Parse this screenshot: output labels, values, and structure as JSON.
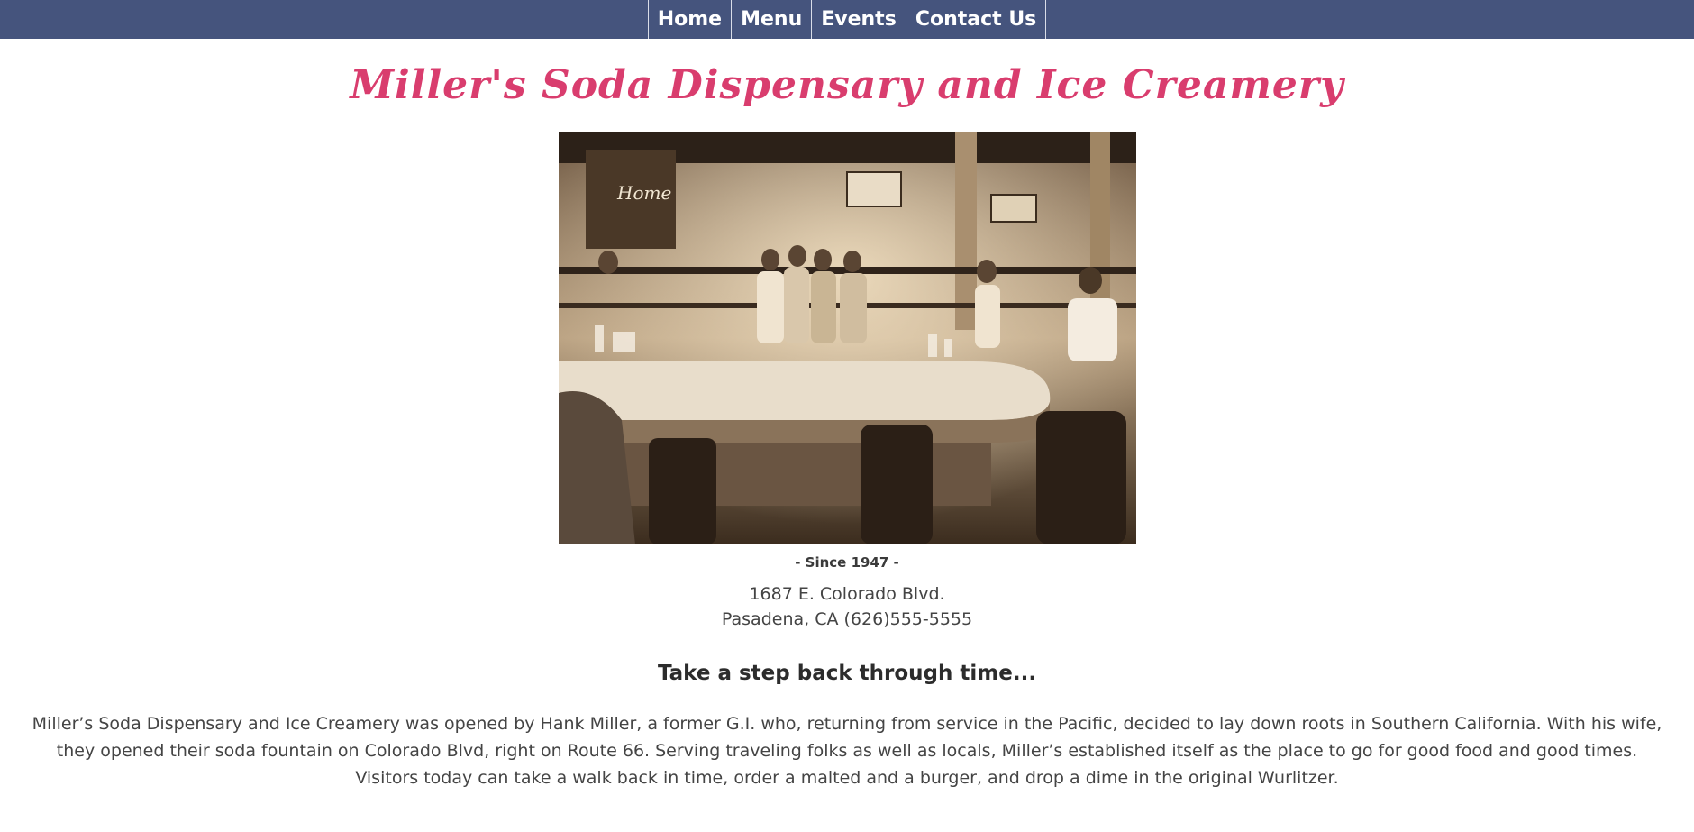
{
  "nav": {
    "items": [
      {
        "label": "Home"
      },
      {
        "label": "Menu"
      },
      {
        "label": "Events"
      },
      {
        "label": "Contact Us"
      }
    ]
  },
  "header": {
    "title": "Miller's Soda Dispensary and Ice Creamery"
  },
  "hero": {
    "photo_alt": "Vintage sepia photo of soda fountain counter with staff",
    "since": "- Since 1947 -"
  },
  "address": {
    "line1": "1687 E. Colorado Blvd.",
    "line2": "Pasadena, CA (626)555-5555"
  },
  "main": {
    "tagline": "Take a step back through time...",
    "story": "Miller’s Soda Dispensary and Ice Creamery was opened by Hank Miller, a former G.I. who, returning from service in the Pacific, decided to lay down roots in Southern California. With his wife, they opened their soda fountain on Colorado Blvd, right on Route 66. Serving traveling folks as well as locals, Miller’s established itself as the place to go for good food and good times. Visitors today can take a walk back in time, order a malted and a burger, and drop a dime in the original Wurlitzer."
  },
  "colors": {
    "nav_bg": "#45547d",
    "title": "#d93d6e",
    "text": "#444444"
  }
}
